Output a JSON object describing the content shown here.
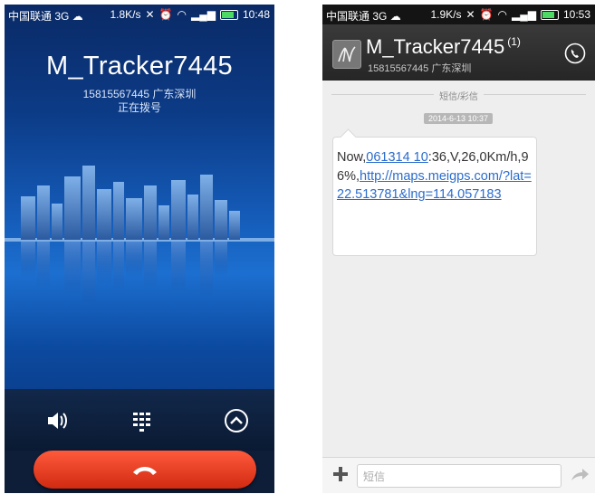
{
  "call_screen": {
    "status_bar": {
      "carrier": "中国联通 3G",
      "speed": "1.8K/s",
      "time": "10:48"
    },
    "caller_name": "M_Tracker7445",
    "caller_number": "15815567445 广东深圳",
    "call_status": "正在拨号",
    "controls": [
      "speaker-icon",
      "dialpad-icon",
      "collapse-up-icon"
    ],
    "end_call_icon": "phone-hangup-icon",
    "colors": {
      "end_call": "#e03a1e",
      "background": "#1459b5"
    }
  },
  "sms_screen": {
    "status_bar": {
      "carrier": "中国联通 3G",
      "speed": "1.9K/s",
      "time": "10:53"
    },
    "contact_name": "M_Tracker7445",
    "unread_count": "(1)",
    "contact_number": "15815567445 广东深圳",
    "divider_label": "短信/彩信",
    "date": "2014-6-13 10:37",
    "message": {
      "prefix": "Now,",
      "link1": "061314 10",
      "middle": ":36,V,26,0Km/h,96%,",
      "link2": "http://maps.meigps.com/?lat=22.513781&lng=114.057183"
    },
    "input_placeholder": "短信",
    "colors": {
      "link": "#2b6ccc",
      "header": "#2e2e2e"
    }
  }
}
